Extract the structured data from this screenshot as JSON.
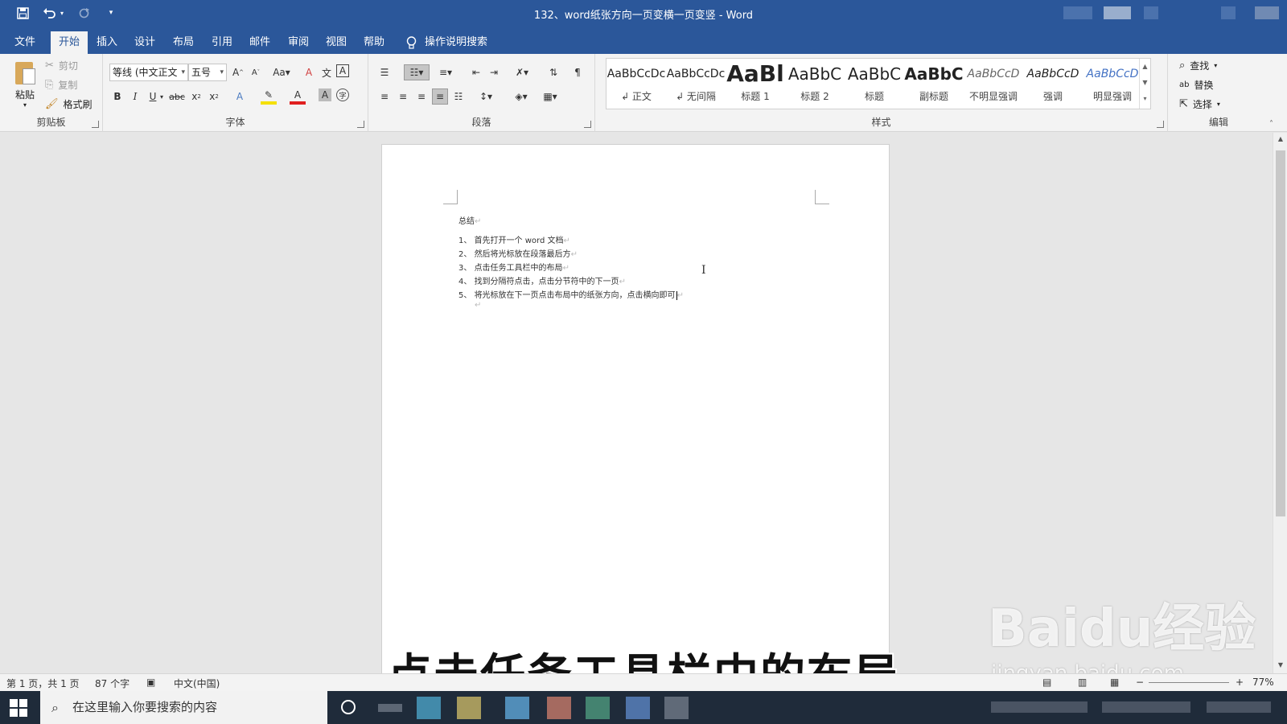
{
  "window": {
    "title": "132、word纸张方向一页变横一页变竖 - Word"
  },
  "qat": {
    "save_icon": "save-icon",
    "undo_icon": "undo-icon",
    "redo_icon": "redo-icon",
    "customize_icon": "chevron-down-icon"
  },
  "tabs": [
    "文件",
    "开始",
    "插入",
    "设计",
    "布局",
    "引用",
    "邮件",
    "审阅",
    "视图",
    "帮助"
  ],
  "active_tab": "开始",
  "tell_me": "操作说明搜索",
  "clipboard": {
    "paste": "粘贴",
    "cut": "剪切",
    "copy": "复制",
    "format_painter": "格式刷",
    "group_label": "剪贴板"
  },
  "font": {
    "name": "等线 (中文正文",
    "size": "五号",
    "group_label": "字体"
  },
  "paragraph": {
    "group_label": "段落"
  },
  "styles": {
    "items": [
      {
        "sample": "AaBbCcDc",
        "name": "↲ 正文"
      },
      {
        "sample": "AaBbCcDc",
        "name": "↲ 无间隔"
      },
      {
        "sample": "AaBl",
        "name": "标题 1"
      },
      {
        "sample": "AaBbC",
        "name": "标题 2"
      },
      {
        "sample": "AaBbC",
        "name": "标题"
      },
      {
        "sample": "AaBbC",
        "name": "副标题"
      },
      {
        "sample": "AaBbCcD",
        "name": "不明显强调"
      },
      {
        "sample": "AaBbCcD",
        "name": "强调"
      },
      {
        "sample": "AaBbCcD",
        "name": "明显强调"
      }
    ],
    "group_label": "样式"
  },
  "editing": {
    "find": "查找",
    "replace": "替换",
    "select": "选择",
    "group_label": "编辑"
  },
  "document": {
    "heading": "总结",
    "list": [
      {
        "num": "1、",
        "text": "首先打开一个 word 文档"
      },
      {
        "num": "2、",
        "text": "然后将光标放在段落最后方"
      },
      {
        "num": "3、",
        "text": "点击任务工具栏中的布局"
      },
      {
        "num": "4、",
        "text": "找到分隔符点击，点击分节符中的下一页"
      },
      {
        "num": "5、",
        "text": "将光标放在下一页点击布局中的纸张方向，点击横向即可"
      }
    ],
    "para_mark": "↵"
  },
  "subtitle": "点击任务工具栏中的布局",
  "watermark": {
    "logo": "Baidu经验",
    "url": "jingyan.baidu.com"
  },
  "statusbar": {
    "page": "第 1 页，共 1 页",
    "words": "87 个字",
    "language": "中文(中国)",
    "zoom": "77%"
  },
  "taskbar": {
    "search_placeholder": "在这里输入你要搜索的内容"
  },
  "colors": {
    "accent": "#2b579a",
    "ribbon_bg": "#f3f3f3",
    "doc_bg": "#e6e6e6",
    "taskbar_bg": "#1f2b3a"
  }
}
